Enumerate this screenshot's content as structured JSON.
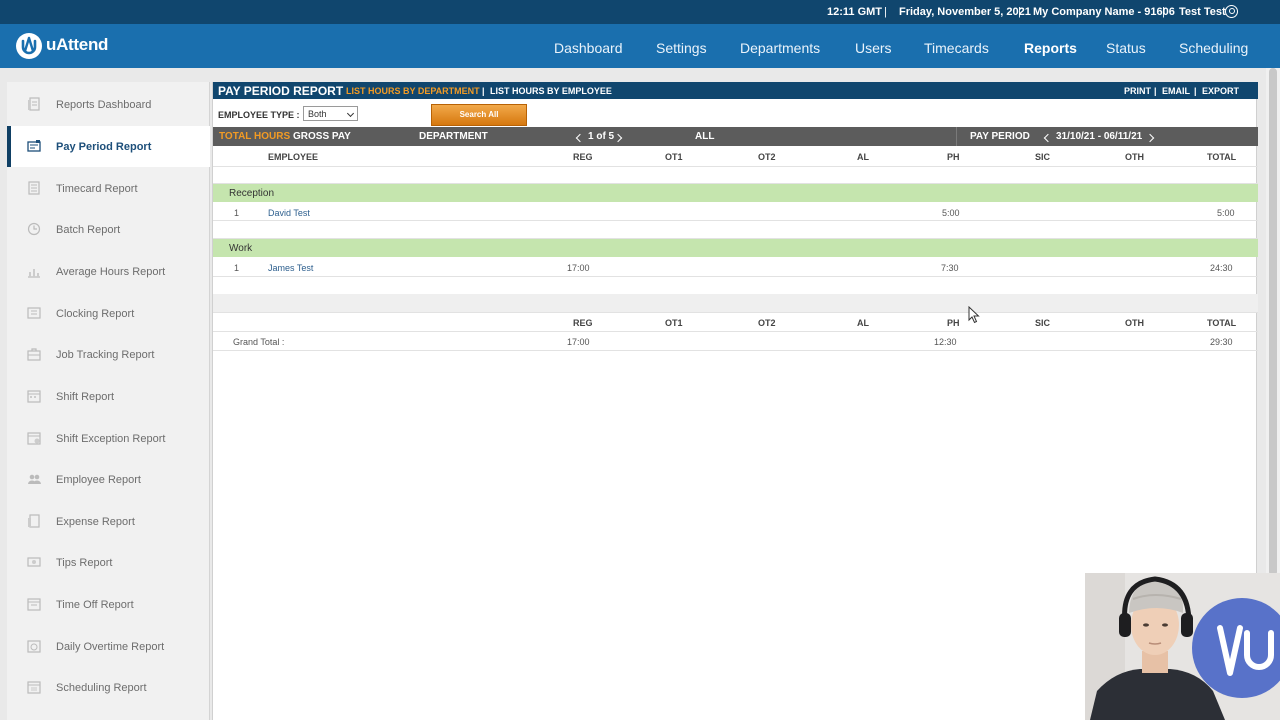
{
  "topbar": {
    "time": "12:11 GMT",
    "date": "Friday, November 5, 2021",
    "company": "My Company Name - 91606",
    "user": "Test Test",
    "separator": "|"
  },
  "brand": {
    "name": "uAttend",
    "logo_color": "#1a6fae"
  },
  "nav": {
    "items": [
      "Dashboard",
      "Settings",
      "Departments",
      "Users",
      "Timecards",
      "Reports",
      "Status",
      "Scheduling"
    ],
    "active": "Reports"
  },
  "sidebar": {
    "items": [
      {
        "label": "Reports Dashboard",
        "icon": "reports-dashboard-icon"
      },
      {
        "label": "Pay Period Report",
        "icon": "pay-period-icon",
        "active": true
      },
      {
        "label": "Timecard Report",
        "icon": "timecard-icon"
      },
      {
        "label": "Batch Report",
        "icon": "batch-icon"
      },
      {
        "label": "Average Hours Report",
        "icon": "average-hours-icon"
      },
      {
        "label": "Clocking Report",
        "icon": "clocking-icon"
      },
      {
        "label": "Job Tracking Report",
        "icon": "job-tracking-icon"
      },
      {
        "label": "Shift Report",
        "icon": "shift-icon"
      },
      {
        "label": "Shift Exception Report",
        "icon": "shift-exception-icon"
      },
      {
        "label": "Employee Report",
        "icon": "employee-icon"
      },
      {
        "label": "Expense Report",
        "icon": "expense-icon"
      },
      {
        "label": "Tips Report",
        "icon": "tips-icon"
      },
      {
        "label": "Time Off Report",
        "icon": "time-off-icon"
      },
      {
        "label": "Daily Overtime Report",
        "icon": "daily-overtime-icon"
      },
      {
        "label": "Scheduling Report",
        "icon": "scheduling-icon"
      }
    ]
  },
  "report": {
    "title": "PAY PERIOD REPORT",
    "link_by_department": "LIST HOURS BY DEPARTMENT",
    "link_separator": "|",
    "link_by_employee": "LIST HOURS BY EMPLOYEE",
    "actions": {
      "print": "PRINT",
      "email": "EMAIL",
      "export": "EXPORT"
    },
    "employee_type_label": "EMPLOYEE TYPE :",
    "employee_type_value": "Both",
    "search_button": "Search All",
    "total_hours_label": "TOTAL HOURS",
    "gross_pay_label": "GROSS PAY",
    "department_label": "DEPARTMENT",
    "pager": "1 of 5",
    "department_value": "ALL",
    "pay_period_label": "PAY PERIOD",
    "pay_period_value": "31/10/21 - 06/11/21",
    "columns": [
      "EMPLOYEE",
      "REG",
      "OT1",
      "OT2",
      "AL",
      "PH",
      "SIC",
      "OTH",
      "TOTAL"
    ],
    "departments": [
      {
        "name": "Reception",
        "rows": [
          {
            "num": "1",
            "employee": "David Test",
            "reg": "",
            "ph": "5:00",
            "total": "5:00"
          }
        ]
      },
      {
        "name": "Work",
        "rows": [
          {
            "num": "1",
            "employee": "James Test",
            "reg": "17:00",
            "ph": "7:30",
            "total": "24:30"
          }
        ]
      }
    ],
    "grand_total": {
      "label": "Grand Total :",
      "reg": "17:00",
      "ph": "12:30",
      "total": "29:30"
    }
  },
  "colors": {
    "header_dark": "#10466e",
    "nav_blue": "#1a6fae",
    "accent_orange": "#f29b24",
    "dept_green": "#c5e5ae"
  }
}
